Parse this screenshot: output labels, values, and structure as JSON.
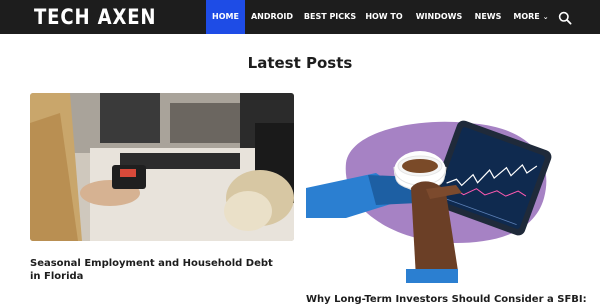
{
  "site": {
    "logo": "TECH AXEN"
  },
  "nav": {
    "items": [
      {
        "label": "HOME",
        "active": true
      },
      {
        "label": "ANDROID",
        "active": false
      },
      {
        "label": "BEST PICKS",
        "active": false
      },
      {
        "label": "HOW TO",
        "active": false
      },
      {
        "label": "WINDOWS",
        "active": false
      },
      {
        "label": "NEWS",
        "active": false
      },
      {
        "label": "MORE",
        "active": false,
        "icon": "chevron-down-icon"
      }
    ],
    "search_icon": "search-icon"
  },
  "main": {
    "section_title": "Latest Posts",
    "posts": [
      {
        "title": "Seasonal Employment and Household Debt in Florida"
      },
      {
        "title": "Why Long-Term Investors Should Consider a SFBI:"
      }
    ]
  },
  "colors": {
    "topbar": "#1d1d1d",
    "accent": "#1e4ce6",
    "text": "#1d1d1d"
  }
}
